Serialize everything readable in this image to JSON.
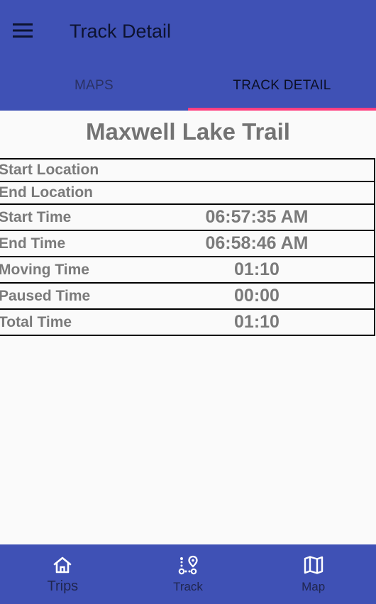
{
  "appbar": {
    "title": "Track Detail",
    "menu_icon": "hamburger-menu-icon"
  },
  "tabs": [
    {
      "label": "MAPS",
      "active": false
    },
    {
      "label": "TRACK DETAIL",
      "active": true
    }
  ],
  "colors": {
    "primary": "#3f51b5",
    "tab_indicator": "#ff4081",
    "background": "#fafafa",
    "text_gray": "#7a7a7a"
  },
  "track": {
    "name": "Maxwell Lake Trail",
    "rows": [
      {
        "label": "Start Location",
        "value": ""
      },
      {
        "label": "End Location",
        "value": ""
      },
      {
        "label": "Start Time",
        "value": "06:57:35 AM"
      },
      {
        "label": "End Time",
        "value": "06:58:46 AM"
      },
      {
        "label": "Moving Time",
        "value": "01:10"
      },
      {
        "label": "Paused Time",
        "value": "00:00"
      },
      {
        "label": "Total Time",
        "value": "01:10"
      }
    ]
  },
  "bottom_nav": [
    {
      "label": "Trips",
      "icon": "home-icon",
      "active": true
    },
    {
      "label": "Track",
      "icon": "route-icon",
      "active": false
    },
    {
      "label": "Map",
      "icon": "map-icon",
      "active": false
    }
  ]
}
